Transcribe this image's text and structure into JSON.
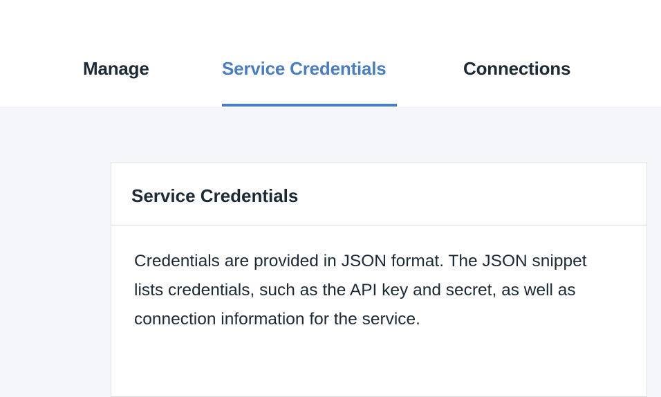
{
  "tabs": {
    "manage": "Manage",
    "service_credentials": "Service Credentials",
    "connections": "Connections",
    "active": "service_credentials"
  },
  "card": {
    "title": "Service Credentials",
    "description": "Credentials are provided in JSON format. The JSON snippet lists credentials, such as the API key and secret, as well as connection information for the service."
  },
  "colors": {
    "accent": "#4a7ec2",
    "text": "#1c2a36",
    "page_background": "#f4f6f9",
    "border": "#dfe3e8"
  }
}
